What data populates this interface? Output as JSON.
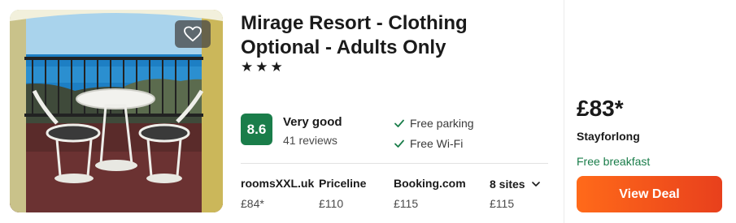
{
  "hotel": {
    "name": "Mirage Resort - Clothing Optional - Adults Only",
    "stars_text": "★★★",
    "star_count": 3
  },
  "rating": {
    "score": "8.6",
    "label": "Very good",
    "reviews": "41 reviews",
    "badge_color": "#1a7d4a"
  },
  "amenities": [
    "Free parking",
    "Free Wi-Fi"
  ],
  "sites": [
    {
      "name": "roomsXXL.uk",
      "price": "£84*"
    },
    {
      "name": "Priceline",
      "price": "£110"
    },
    {
      "name": "Booking.com",
      "price": "£115"
    }
  ],
  "more_sites": {
    "label": "8 sites",
    "price": "£115"
  },
  "deal": {
    "price": "£83*",
    "provider": "Stayforlong",
    "perk": "Free breakfast",
    "button_label": "View Deal",
    "button_color": "#f05a1e"
  },
  "icons": {
    "favorite": "heart-icon",
    "amenity_check": "check-icon",
    "more_sites": "chevron-down-icon"
  }
}
